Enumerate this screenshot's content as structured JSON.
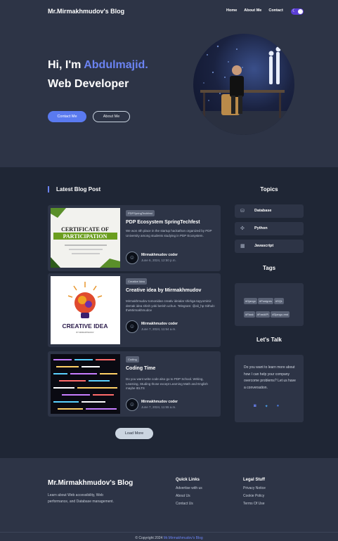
{
  "header": {
    "brand": "Mr.Mirmakhmudov's Blog",
    "nav": [
      "Home",
      "About Me",
      "Contact"
    ],
    "theme_toggle_icon": "moon-icon"
  },
  "hero": {
    "greeting": "Hi, I'm ",
    "name": "Abdulmajid.",
    "role": "Web Developer",
    "contact_button": "Contact Me",
    "about_button": "About Me",
    "accent": "#6b83f2"
  },
  "blog": {
    "section_title": "Latest Blog Post",
    "load_more": "Load More",
    "posts": [
      {
        "badge": "PDPSpringTechfest",
        "title": "PDP Ecosystem SpringTechfest",
        "desc": "We won 4th place in the startup hackathon organized by PDP University among students studying in PDP Ecosystem.",
        "author": "Mirmakhmudov coder",
        "date": "June 6, 2024, 12:50 p.m."
      },
      {
        "badge": "Creative Idea",
        "title": "Creative idea by Mirmakhmudov",
        "desc": "Mirmakhmudov tomonidan creativ ideialar shirkga tayyorniniz demak idea shish yoki berish uchun. Telegram: @ali_hp Github: theMirmakhmudov",
        "author": "Mirmakhmudov coder",
        "date": "June 7, 2024, 11:54 a.m."
      },
      {
        "badge": "Coding",
        "title": "Coding Time",
        "desc": "Do you want write code also go to PDP School. Writing, Learning, Studing those except Learning Math and English maybe IELTS",
        "author": "Mirmakhmudov coder",
        "date": "June 7, 2024, 11:55 a.m."
      }
    ]
  },
  "sidebar": {
    "topics_title": "Topics",
    "topics": [
      {
        "label": "Database",
        "icon": "database-icon"
      },
      {
        "label": "Python",
        "icon": "python-icon"
      },
      {
        "label": "Javascript",
        "icon": "javascript-icon"
      }
    ],
    "tags_title": "Tags",
    "tags": [
      "#Django",
      "#Postgres",
      "#SQL",
      "#Flask",
      "#FastAPI",
      "#Django-rest"
    ],
    "talk_title": "Let's Talk",
    "talk_text": "Do you want to learn more about how I can help your company overcome problems? Let us have a conversation.",
    "socials": [
      "instagram-icon",
      "twitter-icon",
      "facebook-icon"
    ]
  },
  "thumbs": {
    "cert_line1": "CERTIFICATE OF",
    "cert_line2": "PARTICIPATION",
    "creative_line1": "CREATIVE IDEA",
    "creative_line2": "BY MIRMAKHMUDOV"
  },
  "footer": {
    "brand": "Mr.Mirmakhmudov's Blog",
    "about": "Learn about Web accessibility, Web performance, and Database management.",
    "quick_links_title": "Quick Links",
    "quick_links": [
      "Advertise with us",
      "About Us",
      "Contact Us"
    ],
    "legal_title": "Legal Stuff",
    "legal_links": [
      "Privacy Notice",
      "Cookie Policy",
      "Terms Of Use"
    ],
    "copyright_prefix": "© Copyright 2024 ",
    "copyright_brand": "Mr.Mirmakhmudov's Blog"
  }
}
